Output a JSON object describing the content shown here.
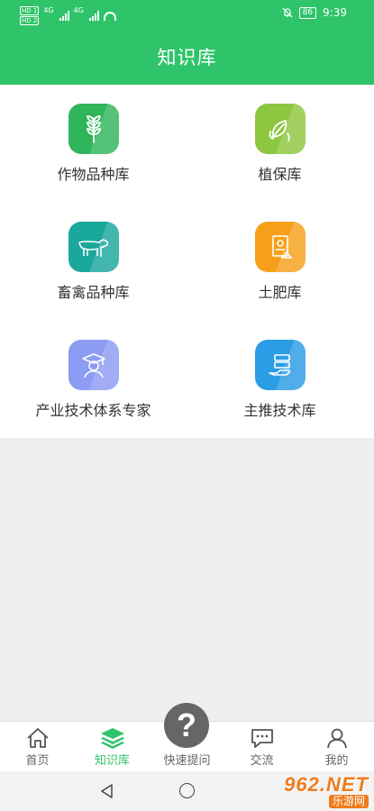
{
  "status_bar": {
    "sim1": "HD 1",
    "sim2": "HD 2",
    "net1": "4G",
    "net2": "4G",
    "battery": "86",
    "time": "9:39"
  },
  "header": {
    "title": "知识库"
  },
  "library_items": [
    {
      "label": "作物品种库",
      "icon": "wheat-icon",
      "color": "#2fb55a"
    },
    {
      "label": "植保库",
      "icon": "leaf-icon",
      "color": "#8dc63f"
    },
    {
      "label": "畜禽品种库",
      "icon": "cow-icon",
      "color": "#1aa79c"
    },
    {
      "label": "土肥库",
      "icon": "fertilizer-bag-icon",
      "color": "#f6a01a"
    },
    {
      "label": "产业技术体系专家",
      "icon": "expert-graduate-icon",
      "color": "#8c9cf2"
    },
    {
      "label": "主推技术库",
      "icon": "tech-hand-icon",
      "color": "#2b9ce6"
    }
  ],
  "tab_bar": {
    "tabs": [
      {
        "label": "首页",
        "icon": "home-icon",
        "active": false
      },
      {
        "label": "知识库",
        "icon": "layers-icon",
        "active": true
      },
      {
        "label": "快速提问",
        "icon": "question-icon",
        "active": false
      },
      {
        "label": "交流",
        "icon": "chat-icon",
        "active": false
      },
      {
        "label": "我的",
        "icon": "person-icon",
        "active": false
      }
    ],
    "ask_symbol": "?"
  },
  "colors": {
    "brand_green": "#2fc46a",
    "inactive_tab": "#666666"
  },
  "watermark": {
    "top": "962.NET",
    "bottom": "乐游网"
  }
}
